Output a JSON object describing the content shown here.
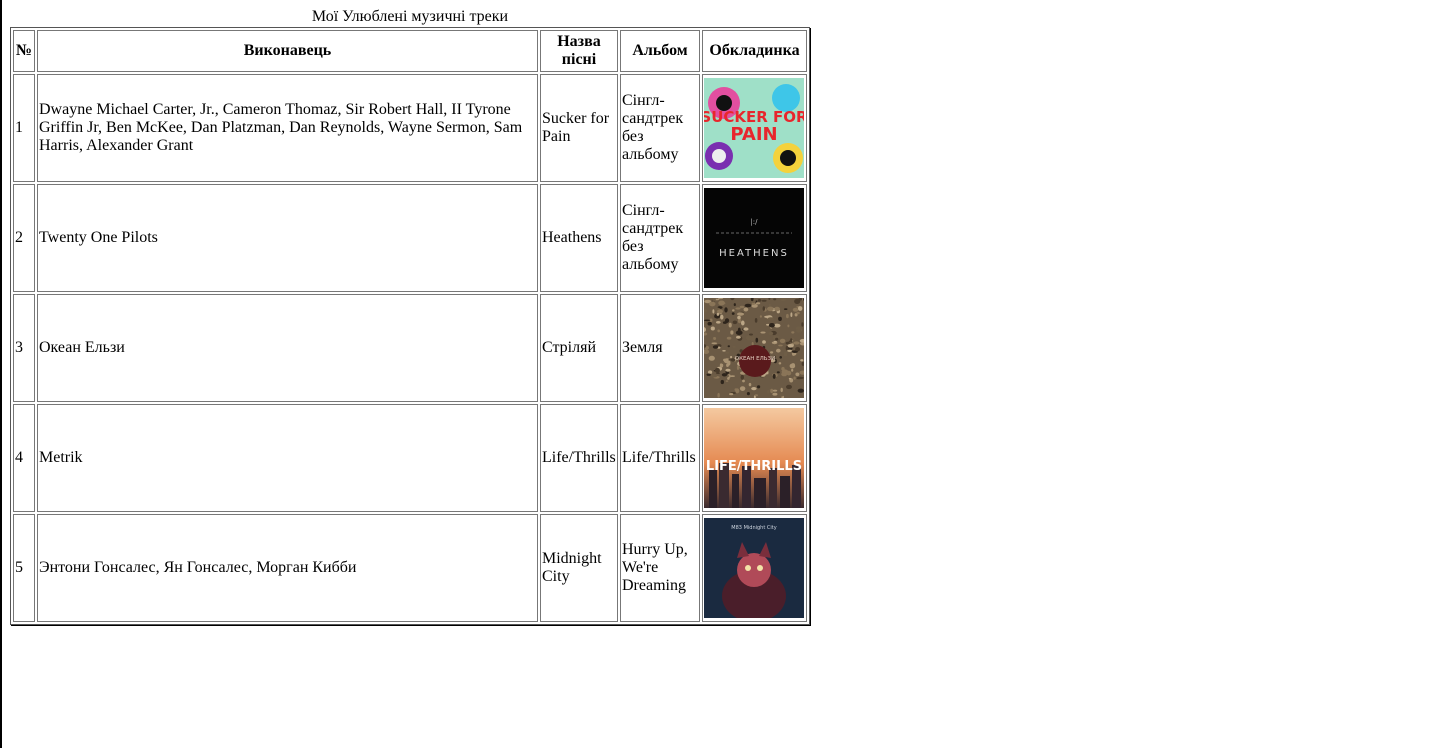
{
  "caption": "Мої Улюблені музичні треки",
  "headers": {
    "num": "№",
    "artist": "Виконавець",
    "song": "Назва пісні",
    "album": "Альбом",
    "cover": "Обкладинка"
  },
  "rows": [
    {
      "num": "1",
      "artist": "Dwayne Michael Carter, Jr., Cameron Thomaz, Sir Robert Hall, II Tyrone Griffin Jr, Ben McKee, Dan Platzman, Dan Reynolds, Wayne Sermon, Sam Harris, Alexander Grant",
      "song": "Sucker for Pain",
      "album": "Сінгл-сандтрек без альбому",
      "cover_icon": "sucker-for-pain-cover",
      "cover_text": "SUCKER FOR PAIN"
    },
    {
      "num": "2",
      "artist": "Twenty One Pilots",
      "song": "Heathens",
      "album": "Сінгл-сандтрек без альбому",
      "cover_icon": "heathens-cover",
      "cover_text": "HEATHENS"
    },
    {
      "num": "3",
      "artist": "Океан Ельзи",
      "song": "Стріляй",
      "album": "Земля",
      "cover_icon": "zemlya-cover",
      "cover_text": "ОКЕАН ЕЛЬЗИ"
    },
    {
      "num": "4",
      "artist": "Metrik",
      "song": "Life/Thrills",
      "album": "Life/Thrills",
      "cover_icon": "life-thrills-cover",
      "cover_text": "LIFE/THRILLS"
    },
    {
      "num": "5",
      "artist": "Энтони Гонсалес, Ян Гонсалес, Морган Кибби",
      "song": "Midnight City",
      "album": "Hurry Up, We're Dreaming",
      "cover_icon": "midnight-city-cover",
      "cover_text": "M83 Midnight City"
    }
  ]
}
